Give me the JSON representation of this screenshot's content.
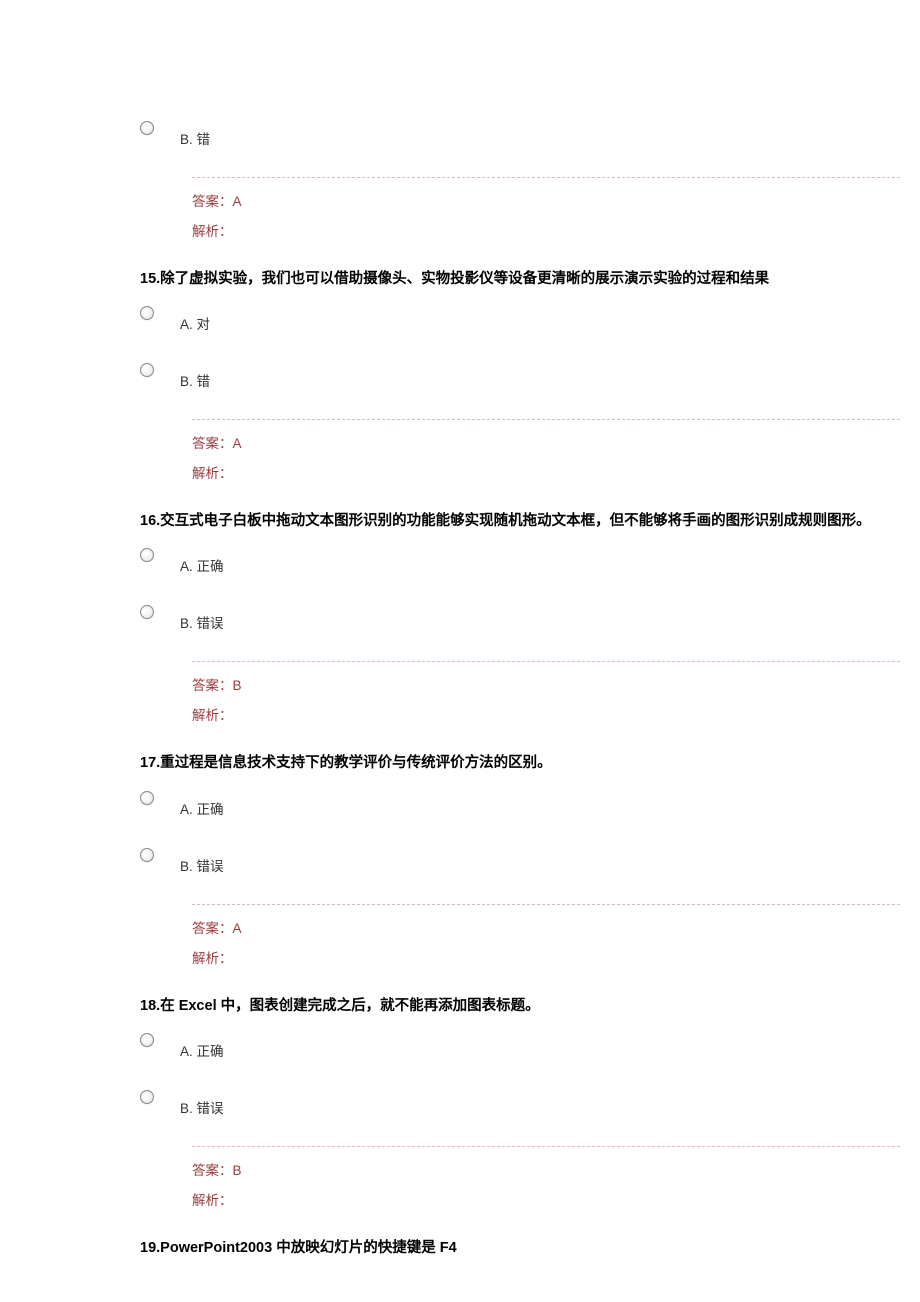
{
  "q14_partial": {
    "option_b": "B. 错",
    "answer_label": "答案：",
    "answer_value": "A",
    "explain_label": "解析："
  },
  "q15": {
    "number": "15.",
    "text": "除了虚拟实验，我们也可以借助摄像头、实物投影仪等设备更清晰的展示演示实验的过程和结果",
    "option_a": "A. 对",
    "option_b": "B. 错",
    "answer_label": "答案：",
    "answer_value": "A",
    "explain_label": "解析："
  },
  "q16": {
    "number": "16.",
    "text": "交互式电子白板中拖动文本图形识别的功能能够实现随机拖动文本框，但不能够将手画的图形识别成规则图形。",
    "option_a": "A. 正确",
    "option_b": "B. 错误",
    "answer_label": "答案：",
    "answer_value": "B",
    "explain_label": "解析："
  },
  "q17": {
    "number": "17.",
    "text": "重过程是信息技术支持下的教学评价与传统评价方法的区别。",
    "option_a": "A. 正确",
    "option_b": "B. 错误",
    "answer_label": "答案：",
    "answer_value": "A",
    "explain_label": "解析："
  },
  "q18": {
    "number": "18.",
    "text": "在 Excel 中，图表创建完成之后，就不能再添加图表标题。",
    "option_a": "A. 正确",
    "option_b": "B. 错误",
    "answer_label": "答案：",
    "answer_value": "B",
    "explain_label": "解析："
  },
  "q19": {
    "number": "19.",
    "text": "PowerPoint2003 中放映幻灯片的快捷键是 F4"
  }
}
